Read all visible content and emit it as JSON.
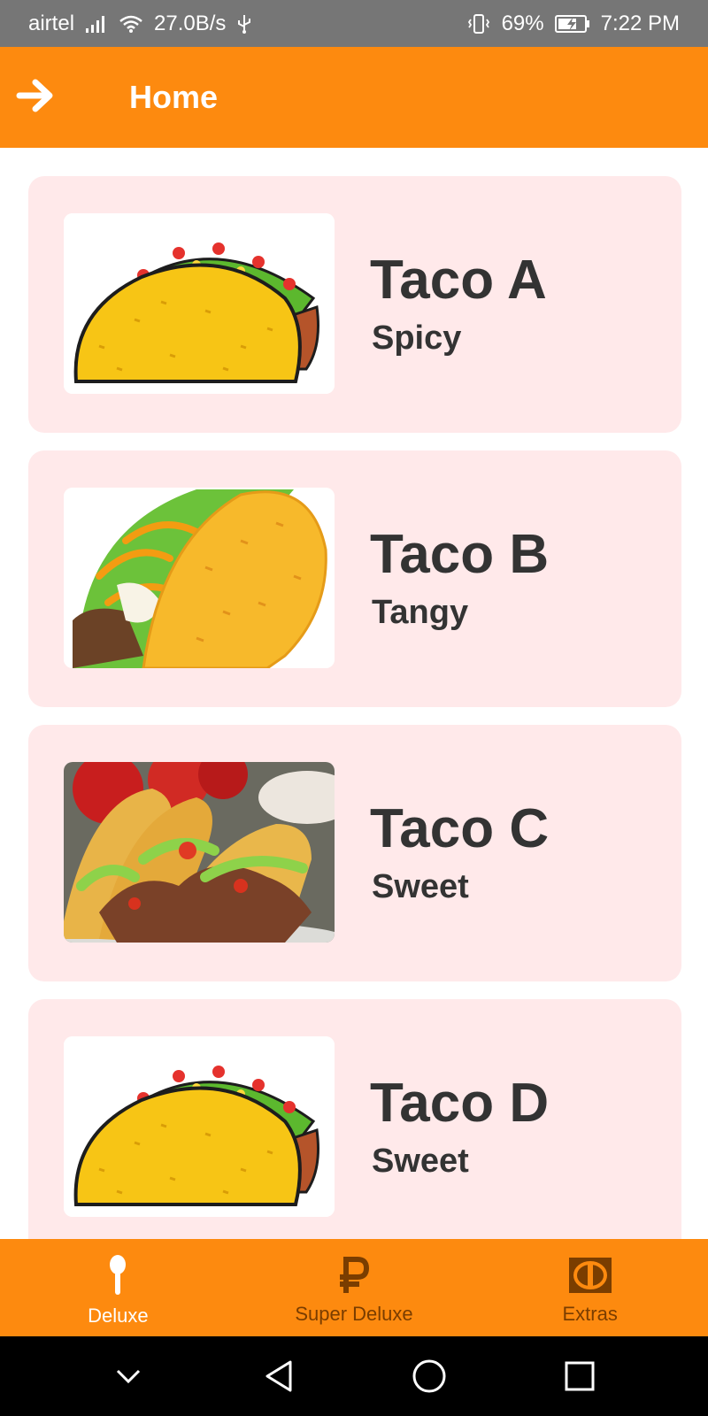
{
  "status_bar": {
    "carrier": "airtel",
    "speed": "27.0B/s",
    "battery": "69%",
    "time": "7:22 PM"
  },
  "app_bar": {
    "title": "Home",
    "back_icon": "arrow-right-icon"
  },
  "items": [
    {
      "name": "Taco A",
      "flavor": "Spicy",
      "image": "taco-cartoon-image"
    },
    {
      "name": "Taco B",
      "flavor": "Tangy",
      "image": "taco-cartoon-image"
    },
    {
      "name": "Taco C",
      "flavor": "Sweet",
      "image": "taco-photo-image"
    },
    {
      "name": "Taco D",
      "flavor": "Sweet",
      "image": "taco-cartoon-image"
    }
  ],
  "bottom_nav": [
    {
      "label": "Deluxe",
      "icon": "spoon-icon",
      "active": true
    },
    {
      "label": "Super Deluxe",
      "icon": "ruble-icon",
      "active": false
    },
    {
      "label": "Extras",
      "icon": "coin-icon",
      "active": false
    }
  ],
  "system_nav": [
    "chevron-down-icon",
    "back-triangle-icon",
    "home-circle-icon",
    "recents-square-icon"
  ],
  "colors": {
    "primary": "#fd8a0f",
    "card_bg": "#ffe9ea",
    "status_bg": "#767676",
    "text_dark": "#333333"
  }
}
